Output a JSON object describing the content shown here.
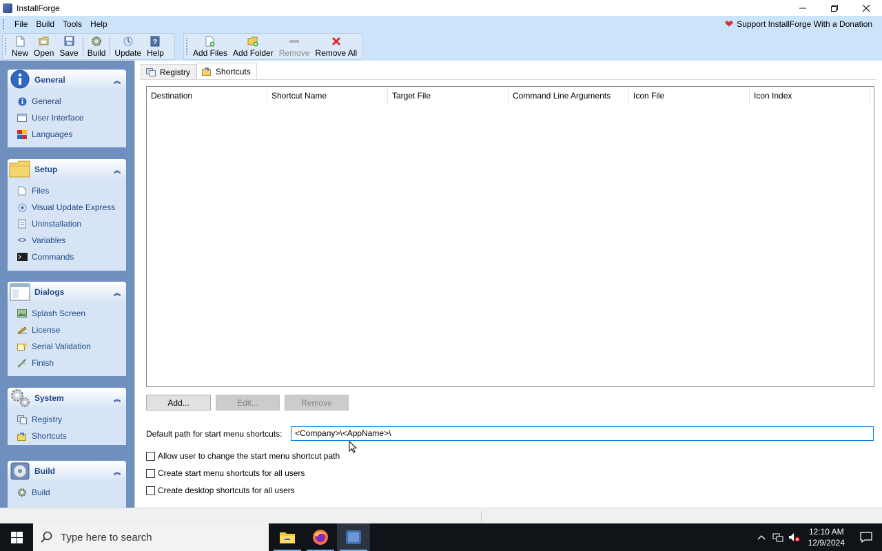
{
  "window": {
    "title": "InstallForge",
    "controls": [
      "minimize",
      "restore",
      "close"
    ]
  },
  "menu": {
    "items": [
      "File",
      "Build",
      "Tools",
      "Help"
    ],
    "donation": "Support InstallForge With a Donation"
  },
  "toolbar1": {
    "buttons": [
      {
        "label": "New",
        "icon": "new-file-icon"
      },
      {
        "label": "Open",
        "icon": "open-folder-icon"
      },
      {
        "label": "Save",
        "icon": "save-icon"
      },
      {
        "label": "Build",
        "icon": "build-gear-icon"
      },
      {
        "label": "Update",
        "icon": "update-icon"
      },
      {
        "label": "Help",
        "icon": "help-book-icon"
      }
    ]
  },
  "toolbar2": {
    "buttons": [
      {
        "label": "Add Files",
        "icon": "add-file-icon",
        "enabled": true
      },
      {
        "label": "Add Folder",
        "icon": "add-folder-icon",
        "enabled": true
      },
      {
        "label": "Remove",
        "icon": "remove-icon",
        "enabled": false
      },
      {
        "label": "Remove All",
        "icon": "remove-all-icon",
        "enabled": true
      }
    ]
  },
  "sidebar": {
    "groups": [
      {
        "title": "General",
        "items": [
          "General",
          "User Interface",
          "Languages"
        ]
      },
      {
        "title": "Setup",
        "items": [
          "Files",
          "Visual Update Express",
          "Uninstallation",
          "Variables",
          "Commands"
        ]
      },
      {
        "title": "Dialogs",
        "items": [
          "Splash Screen",
          "License",
          "Serial Validation",
          "Finish"
        ]
      },
      {
        "title": "System",
        "items": [
          "Registry",
          "Shortcuts"
        ]
      },
      {
        "title": "Build",
        "items": [
          "Build"
        ]
      }
    ]
  },
  "tabs": [
    {
      "label": "Registry",
      "active": false
    },
    {
      "label": "Shortcuts",
      "active": true
    }
  ],
  "shortcuts_table": {
    "columns": [
      "Destination",
      "Shortcut Name",
      "Target File",
      "Command Line Arguments",
      "Icon File",
      "Icon Index"
    ],
    "rows": []
  },
  "buttons": {
    "add": "Add...",
    "edit": "Edit...",
    "remove": "Remove"
  },
  "default_path": {
    "label": "Default path for start menu shortcuts:",
    "value": "<Company>\\<AppName>\\"
  },
  "checkboxes": [
    {
      "label": "Allow user to change the start menu shortcut path",
      "checked": false
    },
    {
      "label": "Create start menu shortcuts for all users",
      "checked": false
    },
    {
      "label": "Create desktop shortcuts for all users",
      "checked": false
    }
  ],
  "taskbar": {
    "search_placeholder": "Type here to search",
    "time": "12:10 AM",
    "date": "12/9/2024"
  },
  "colors": {
    "ribbon_bg": "#cce4fa",
    "sidebar_bg": "#6f8fbf",
    "sidebar_link": "#214a87",
    "input_focus": "#0078d7",
    "taskbar_bg": "#101418"
  }
}
